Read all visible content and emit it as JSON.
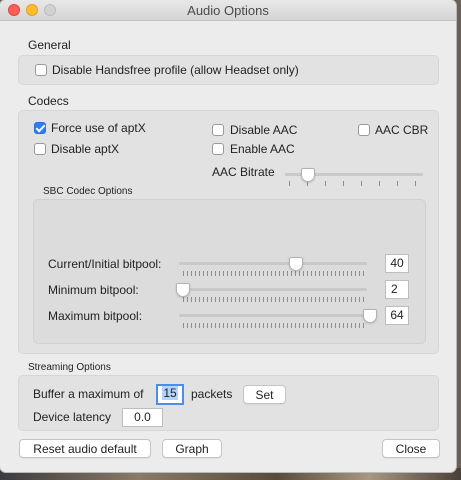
{
  "window": {
    "title": "Audio Options"
  },
  "general": {
    "title": "General",
    "disable_handsfree": {
      "label": "Disable Handsfree profile (allow Headset only)",
      "checked": false
    }
  },
  "codecs": {
    "title": "Codecs",
    "force_aptx": {
      "label": "Force use of aptX",
      "checked": true
    },
    "disable_aptx": {
      "label": "Disable aptX",
      "checked": false
    },
    "disable_aac": {
      "label": "Disable AAC",
      "checked": false
    },
    "enable_aac": {
      "label": "Enable AAC",
      "checked": false
    },
    "aac_cbr": {
      "label": "AAC CBR",
      "checked": false
    },
    "aac_bitrate": {
      "label": "AAC Bitrate",
      "level": 0.12
    }
  },
  "sbc": {
    "title": "SBC Codec Options",
    "current_bitpool": {
      "label": "Current/Initial bitpool:",
      "value": "40"
    },
    "minimum_bitpool": {
      "label": "Minimum bitpool:",
      "value": "2"
    },
    "maximum_bitpool": {
      "label": "Maximum bitpool:",
      "value": "64"
    }
  },
  "streaming": {
    "title": "Streaming Options",
    "buffer_prefix": "Buffer a maximum of",
    "buffer_value": "15",
    "buffer_suffix": "packets",
    "set_button": "Set",
    "latency_label": "Device latency",
    "latency_value": "0.0"
  },
  "footer": {
    "reset_button": "Reset audio default",
    "graph_button": "Graph",
    "close_button": "Close"
  },
  "colors": {
    "accent": "#2f7cf6",
    "close": "#fe5f57",
    "minimize": "#febc2e",
    "maximize_disabled": "#d1d1d1"
  }
}
